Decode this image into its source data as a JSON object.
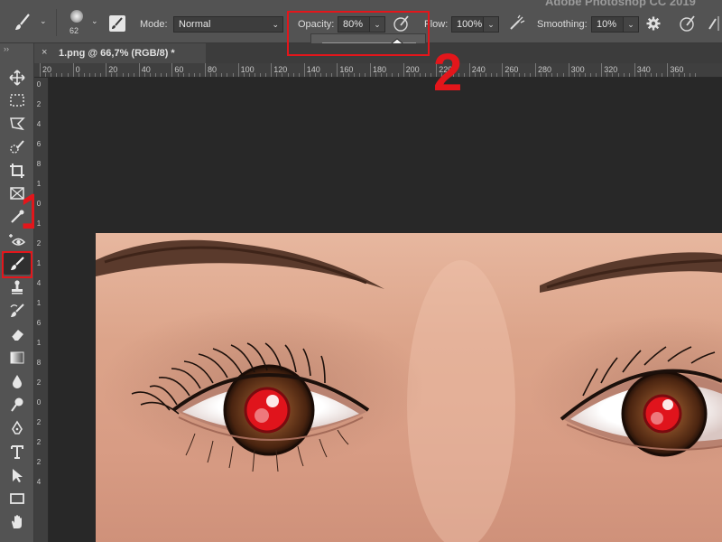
{
  "app_title": "Adobe Photoshop CC 2019",
  "options_bar": {
    "brush_size": "62",
    "mode_label": "Mode:",
    "mode_value": "Normal",
    "opacity_label": "Opacity:",
    "opacity_value": "80%",
    "opacity_slider_fraction": 0.8,
    "flow_label": "Flow:",
    "flow_value": "100%",
    "smoothing_label": "Smoothing:",
    "smoothing_value": "10%"
  },
  "document_tab": {
    "close_glyph": "×",
    "title": "1.png @ 66,7% (RGB/8) *"
  },
  "ruler_top_labels": [
    "20",
    "0",
    "20",
    "40",
    "60",
    "80",
    "100",
    "120",
    "140",
    "160",
    "180",
    "200",
    "220",
    "240",
    "260",
    "280",
    "300",
    "320",
    "340",
    "360"
  ],
  "ruler_left_labels": [
    "0",
    "2",
    "4",
    "6",
    "8",
    "1",
    "0",
    "1",
    "2",
    "1",
    "4",
    "1",
    "6",
    "1",
    "8",
    "2",
    "0",
    "2",
    "2",
    "2",
    "4"
  ],
  "annotations": {
    "step1": "1",
    "step2": "2",
    "color": "#e3161b"
  },
  "toolbar_tools": [
    "move-tool",
    "marquee-tool",
    "lasso-tool",
    "quick-selection-tool",
    "crop-tool",
    "frame-tool",
    "eyedropper-tool",
    "red-eye-tool",
    "brush-tool",
    "clone-stamp-tool",
    "history-brush-tool",
    "eraser-tool",
    "gradient-tool",
    "blur-tool",
    "dodge-tool",
    "pen-tool",
    "type-tool",
    "path-selection-tool",
    "rectangle-tool",
    "hand-tool"
  ]
}
